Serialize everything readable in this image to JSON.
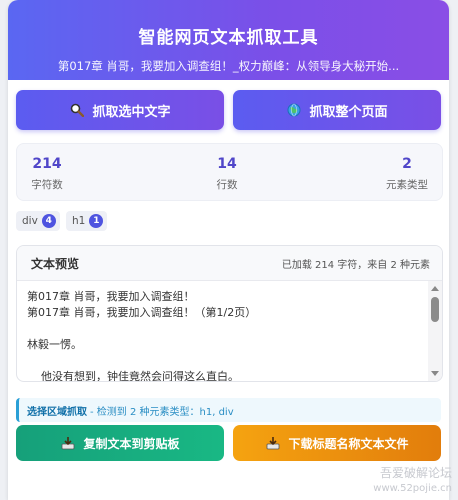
{
  "header": {
    "title": "智能网页文本抓取工具",
    "subtitle": "第017章 肖哥，我要加入调查组！_权力巅峰：从领导身大秘开始..."
  },
  "buttons": {
    "grab_selected": "抓取选中文字",
    "grab_page": "抓取整个页面"
  },
  "stats": [
    {
      "value": "214",
      "label": "字符数"
    },
    {
      "value": "14",
      "label": "行数"
    },
    {
      "value": "2",
      "label": "元素类型"
    }
  ],
  "tags": [
    {
      "name": "div",
      "count": "4"
    },
    {
      "name": "h1",
      "count": "1"
    }
  ],
  "preview": {
    "title": "文本预览",
    "info": "已加载 214 字符，来自 2 种元素",
    "lines": [
      "第017章 肖哥，我要加入调查组！",
      "第017章 肖哥，我要加入调查组！（第1/2页）",
      "",
      "林毅一愣。",
      "",
      "    他没有想到，钟佳竟然会问得这么直白。"
    ]
  },
  "status": {
    "strong": "选择区域抓取",
    "rest": "- 检测到 2 种元素类型：h1, div"
  },
  "actions": {
    "copy": "复制文本到剪贴板",
    "download": "下载标题名称文本文件"
  },
  "watermark": {
    "line1": "吾爱破解论坛",
    "line2": "www.52pojie.cn"
  },
  "icons": {
    "grab_selected": "magnifier-icon",
    "grab_page": "globe-icon",
    "copy": "inbox-tray-icon",
    "download": "inbox-tray-icon"
  }
}
